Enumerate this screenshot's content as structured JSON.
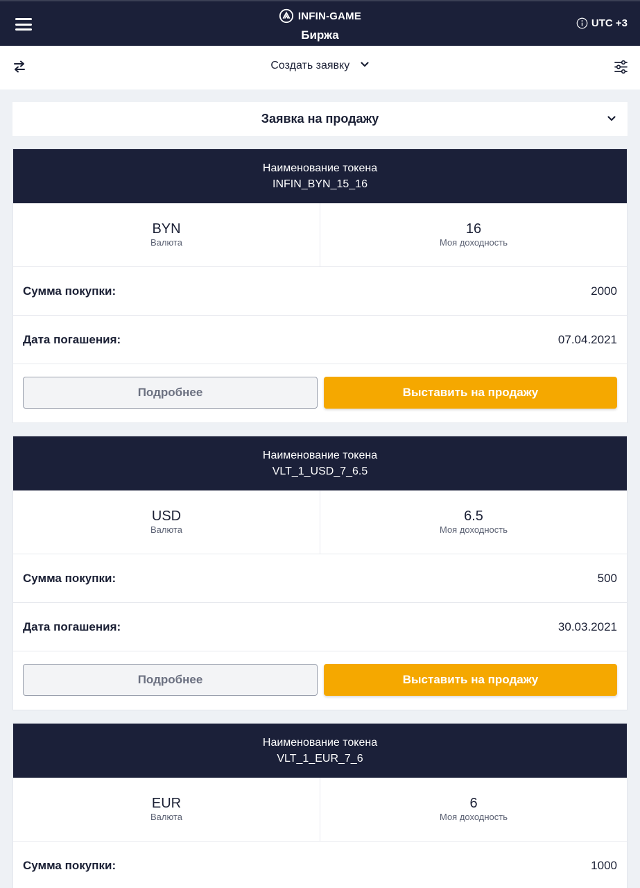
{
  "header": {
    "brand": "INFIN-GAME",
    "page_title": "Биржа",
    "timezone": "UTC +3"
  },
  "toolbar": {
    "create_label": "Создать заявку"
  },
  "order_type": {
    "selected": "Заявка на продажу"
  },
  "labels": {
    "token_name": "Наименование токена",
    "currency": "Валюта",
    "yield": "Моя доходность",
    "purchase_amount": "Сумма покупки:",
    "maturity_date": "Дата погашения:",
    "more_button": "Подробнее",
    "sell_button": "Выставить на продажу"
  },
  "cards": [
    {
      "token": "INFIN_BYN_15_16",
      "currency": "BYN",
      "yield": "16",
      "amount": "2000",
      "date": "07.04.2021"
    },
    {
      "token": "VLT_1_USD_7_6.5",
      "currency": "USD",
      "yield": "6.5",
      "amount": "500",
      "date": "30.03.2021"
    },
    {
      "token": "VLT_1_EUR_7_6",
      "currency": "EUR",
      "yield": "6",
      "amount": "1000"
    }
  ],
  "colors": {
    "header_bg": "#1b2039",
    "accent": "#f5a800",
    "page_bg": "#eef1f5"
  }
}
